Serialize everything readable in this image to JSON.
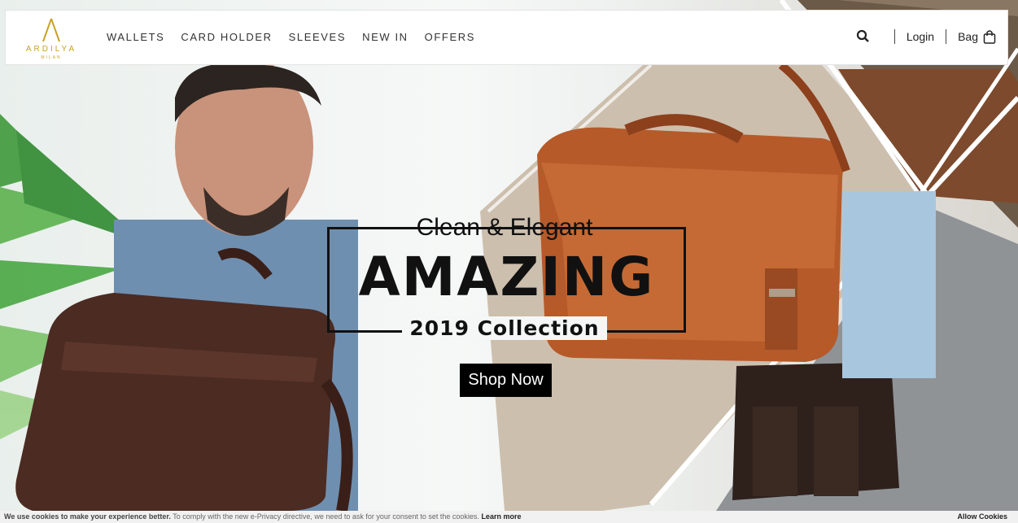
{
  "brand": {
    "name": "ARDILYA",
    "sub": "MILAN",
    "color": "#c9a227"
  },
  "nav": {
    "items": [
      {
        "label": "WALLETS"
      },
      {
        "label": "CARD HOLDER"
      },
      {
        "label": "SLEEVES"
      },
      {
        "label": "NEW IN"
      },
      {
        "label": "OFFERS"
      }
    ]
  },
  "header_right": {
    "search_icon": "search-icon",
    "login_label": "Login",
    "bag_label": "Bag",
    "bag_icon": "shopping-bag-icon"
  },
  "hero": {
    "tagline": "Clean & Elegant",
    "headline": "AMAZING",
    "subline": "2019 Collection",
    "cta_label": "Shop Now"
  },
  "cookie_bar": {
    "bold_text": "We use cookies to make your experience better.",
    "text": " To comply with the new e-Privacy directive, we need to ask for your consent to set the cookies. ",
    "learn_more": "Learn more",
    "allow_label": "Allow Cookies"
  }
}
